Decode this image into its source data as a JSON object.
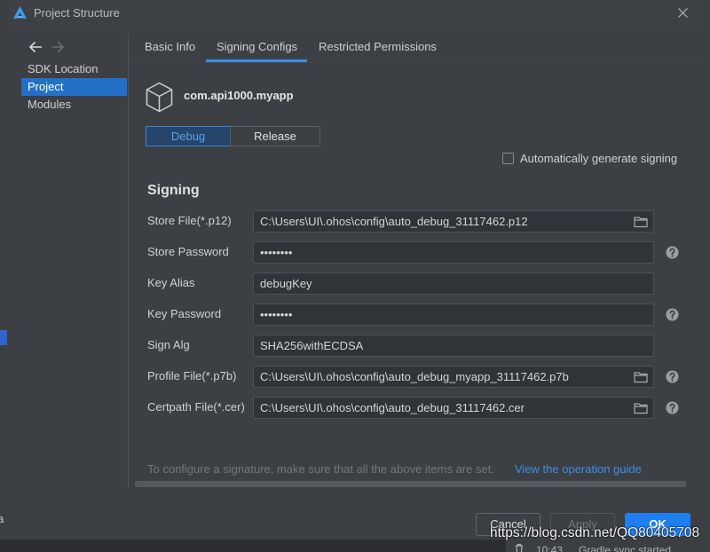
{
  "window": {
    "title": "Project Structure",
    "logo_icon": "deveco-logo-icon",
    "close_icon": "close-icon"
  },
  "navigation": {
    "back_icon": "arrow-left-icon",
    "forward_icon": "arrow-right-icon",
    "forward_enabled": false,
    "items": [
      {
        "label": "SDK Location",
        "selected": false
      },
      {
        "label": "Project",
        "selected": true
      },
      {
        "label": "Modules",
        "selected": false
      }
    ]
  },
  "tabs": [
    {
      "label": "Basic Info",
      "active": false
    },
    {
      "label": "Signing Configs",
      "active": true
    },
    {
      "label": "Restricted Permissions",
      "active": false
    }
  ],
  "project": {
    "name": "com.api1000.myapp",
    "icon": "cube-icon"
  },
  "build_type": {
    "options": [
      "Debug",
      "Release"
    ],
    "selected_index": 0
  },
  "auto_signing": {
    "label": "Automatically generate signing",
    "checked": false
  },
  "signing": {
    "title": "Signing",
    "fields": [
      {
        "label": "Store File(*.p12)",
        "value": "C:\\Users\\UI\\.ohos\\config\\auto_debug_31117462.p12",
        "browse_icon": "folder-icon"
      },
      {
        "label": "Store Password",
        "value": "••••••••",
        "help_icon": "help-icon"
      },
      {
        "label": "Key Alias",
        "value": "debugKey"
      },
      {
        "label": "Key Password",
        "value": "••••••••",
        "help_icon": "help-icon"
      },
      {
        "label": "Sign Alg",
        "value": "SHA256withECDSA"
      },
      {
        "label": "Profile File(*.p7b)",
        "value": "C:\\Users\\UI\\.ohos\\config\\auto_debug_myapp_31117462.p7b",
        "browse_icon": "folder-icon",
        "help_icon": "help-icon"
      },
      {
        "label": "Certpath File(*.cer)",
        "value": "C:\\Users\\UI\\.ohos\\config\\auto_debug_31117462.cer",
        "browse_icon": "folder-icon",
        "help_icon": "help-icon"
      }
    ]
  },
  "hint": {
    "text": "To configure a signature, make sure that all the above items are set.",
    "link": "View the operation guide"
  },
  "buttons": {
    "cancel": "Cancel",
    "apply": "Apply",
    "apply_enabled": false,
    "ok": "OK"
  },
  "watermark": "https://blog.csdn.net/QQ80405708",
  "background": {
    "left_fragment": "a",
    "status_icon": "trash-icon",
    "status_time": "10:43",
    "status_message": "Gradle sync started"
  },
  "colors": {
    "dialog_bg": "#3c3f44",
    "input_bg": "#303337",
    "selection": "#2470c7",
    "ok_button": "#1f7ff0",
    "link": "#3d8fe8",
    "tab_underline": "#3c8ee8",
    "muted_text": "#74777c"
  }
}
